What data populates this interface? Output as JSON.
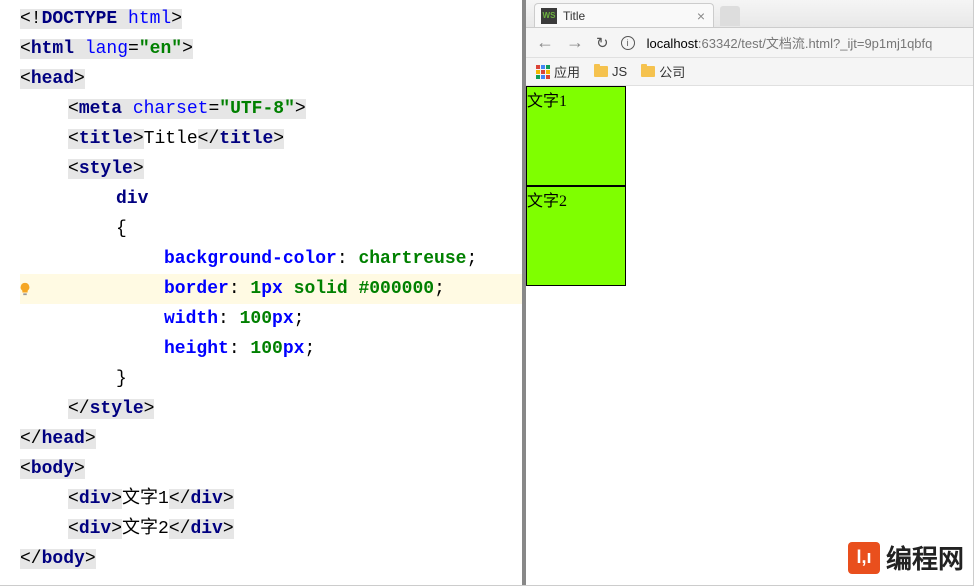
{
  "editor": {
    "lines": [
      {
        "type": "tagline",
        "html": [
          {
            "k": "tb",
            "v": "<!"
          },
          {
            "k": "tn",
            "v": "DOCTYPE "
          },
          {
            "k": "an",
            "v": "html"
          },
          {
            "k": "tb",
            "v": ">"
          }
        ]
      },
      {
        "type": "tagline",
        "html": [
          {
            "k": "tb",
            "v": "<"
          },
          {
            "k": "tn",
            "v": "html "
          },
          {
            "k": "an",
            "v": "lang"
          },
          {
            "k": "tb",
            "v": "="
          },
          {
            "k": "av",
            "v": "\"en\""
          },
          {
            "k": "tb",
            "v": ">"
          }
        ]
      },
      {
        "type": "tagline",
        "html": [
          {
            "k": "tb",
            "v": "<"
          },
          {
            "k": "tn",
            "v": "head"
          },
          {
            "k": "tb",
            "v": ">"
          }
        ]
      },
      {
        "type": "tagline",
        "indent": 1,
        "html": [
          {
            "k": "tb",
            "v": "<"
          },
          {
            "k": "tn",
            "v": "meta "
          },
          {
            "k": "an",
            "v": "charset"
          },
          {
            "k": "tb",
            "v": "="
          },
          {
            "k": "av",
            "v": "\"UTF-8\""
          },
          {
            "k": "tb",
            "v": ">"
          }
        ]
      },
      {
        "type": "tagline",
        "indent": 1,
        "html": [
          {
            "k": "tb",
            "v": "<"
          },
          {
            "k": "tn",
            "v": "title"
          },
          {
            "k": "tb",
            "v": ">"
          },
          {
            "k": "tx",
            "v": "Title"
          },
          {
            "k": "tb",
            "v": "</"
          },
          {
            "k": "tn",
            "v": "title"
          },
          {
            "k": "tb",
            "v": ">"
          }
        ]
      },
      {
        "type": "tagline",
        "indent": 1,
        "html": [
          {
            "k": "tb",
            "v": "<"
          },
          {
            "k": "tn",
            "v": "style"
          },
          {
            "k": "tb",
            "v": ">"
          }
        ]
      },
      {
        "type": "css",
        "indent": 2,
        "html": [
          {
            "k": "sel",
            "v": "div"
          }
        ]
      },
      {
        "type": "css",
        "indent": 2,
        "html": [
          {
            "k": "br",
            "v": "{"
          }
        ]
      },
      {
        "type": "css",
        "indent": 3,
        "html": [
          {
            "k": "pr",
            "v": "background-color"
          },
          {
            "k": "tx",
            "v": ": "
          },
          {
            "k": "vl",
            "v": "chartreuse"
          },
          {
            "k": "tx",
            "v": ";"
          }
        ]
      },
      {
        "type": "css",
        "indent": 3,
        "highlight": true,
        "bulb": true,
        "html": [
          {
            "k": "pr",
            "v": "border"
          },
          {
            "k": "tx",
            "v": ": "
          },
          {
            "k": "vl",
            "v": "1"
          },
          {
            "k": "pr",
            "v": "px "
          },
          {
            "k": "vl",
            "v": "solid #000000"
          },
          {
            "k": "tx",
            "v": ";"
          }
        ]
      },
      {
        "type": "css",
        "indent": 3,
        "html": [
          {
            "k": "pr",
            "v": "width"
          },
          {
            "k": "tx",
            "v": ": "
          },
          {
            "k": "vl",
            "v": "100"
          },
          {
            "k": "pr",
            "v": "px"
          },
          {
            "k": "tx",
            "v": ";"
          }
        ]
      },
      {
        "type": "css",
        "indent": 3,
        "html": [
          {
            "k": "pr",
            "v": "height"
          },
          {
            "k": "tx",
            "v": ": "
          },
          {
            "k": "vl",
            "v": "100"
          },
          {
            "k": "pr",
            "v": "px"
          },
          {
            "k": "tx",
            "v": ";"
          }
        ]
      },
      {
        "type": "css",
        "indent": 2,
        "html": [
          {
            "k": "br",
            "v": "}"
          }
        ]
      },
      {
        "type": "tagline",
        "indent": 1,
        "html": [
          {
            "k": "tb",
            "v": "</"
          },
          {
            "k": "tn",
            "v": "style"
          },
          {
            "k": "tb",
            "v": ">"
          }
        ]
      },
      {
        "type": "tagline",
        "html": [
          {
            "k": "tb",
            "v": "</"
          },
          {
            "k": "tn",
            "v": "head"
          },
          {
            "k": "tb",
            "v": ">"
          }
        ]
      },
      {
        "type": "tagline",
        "html": [
          {
            "k": "tb",
            "v": "<"
          },
          {
            "k": "tn",
            "v": "body"
          },
          {
            "k": "tb",
            "v": ">"
          }
        ]
      },
      {
        "type": "tagline",
        "indent": 1,
        "html": [
          {
            "k": "tb",
            "v": "<"
          },
          {
            "k": "tn",
            "v": "div"
          },
          {
            "k": "tb",
            "v": ">"
          },
          {
            "k": "tx",
            "v": "文字1"
          },
          {
            "k": "tb",
            "v": "</"
          },
          {
            "k": "tn",
            "v": "div"
          },
          {
            "k": "tb",
            "v": ">"
          }
        ]
      },
      {
        "type": "tagline",
        "indent": 1,
        "html": [
          {
            "k": "tb",
            "v": "<"
          },
          {
            "k": "tn",
            "v": "div"
          },
          {
            "k": "tb",
            "v": ">"
          },
          {
            "k": "tx",
            "v": "文字2"
          },
          {
            "k": "tb",
            "v": "</"
          },
          {
            "k": "tn",
            "v": "div"
          },
          {
            "k": "tb",
            "v": ">"
          }
        ]
      },
      {
        "type": "tagline",
        "html": [
          {
            "k": "tb",
            "v": "</"
          },
          {
            "k": "tn",
            "v": "body"
          },
          {
            "k": "tb",
            "v": ">"
          }
        ]
      }
    ]
  },
  "browser": {
    "tab_title": "Title",
    "tab_favicon_text": "WS",
    "url_host": "localhost",
    "url_port": ":63342",
    "url_path": "/test/文档流.html?_ijt=9p1mj1qbfq",
    "bookmarks": {
      "apps_label": "应用",
      "items": [
        "JS",
        "公司"
      ]
    },
    "page": {
      "div1_text": "文字1",
      "div2_text": "文字2"
    }
  },
  "watermark": {
    "logo_text": "l,ı",
    "brand": "编程网"
  }
}
